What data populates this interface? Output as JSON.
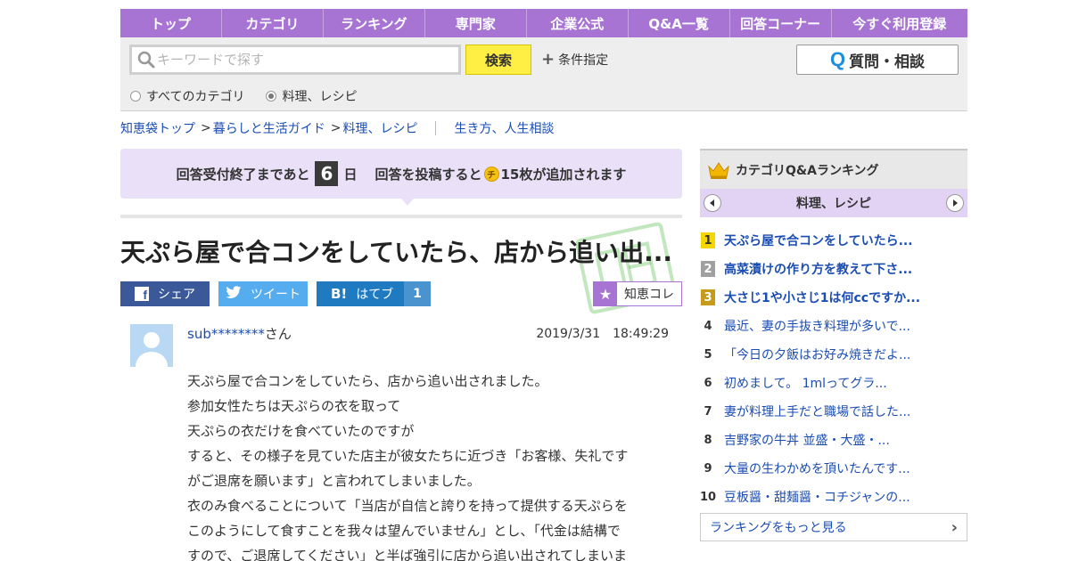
{
  "nav": {
    "items": [
      "トップ",
      "カテゴリ",
      "ランキング",
      "専門家",
      "企業公式",
      "Q&A一覧",
      "回答コーナー",
      "今すぐ利用登録"
    ]
  },
  "search": {
    "placeholder": "キーワードで探す",
    "button": "検索",
    "condition": "条件指定",
    "ask_button": "質問・相談",
    "ask_icon": "Q",
    "radio_all": "すべてのカテゴリ",
    "radio_cat": "料理、レシピ",
    "selected": "料理、レシピ"
  },
  "breadcrumb": {
    "items": [
      "知恵袋トップ",
      "暮らしと生活ガイド",
      "料理、レシピ"
    ],
    "separator": ">",
    "related": "生き方、人生相談"
  },
  "notice": {
    "prefix": "回答受付終了まであと",
    "days": "6",
    "unit": "日",
    "middle": "回答を投稿すると",
    "coin": "チ",
    "suffix": "15枚が追加されます"
  },
  "question": {
    "title": "天ぷら屋で合コンをしていたら、店から追い出...",
    "user": "sub********",
    "user_suffix": "さん",
    "datetime": "2019/3/31　18:49:29",
    "lines": [
      "天ぷら屋で合コンをしていたら、店から追い出されました。",
      "参加女性たちは天ぷらの衣を取って",
      "天ぷらの衣だけを食べていたのですが",
      "すると、その様子を見ていた店主が彼女たちに近づき「お客様、失礼です",
      "がご退席を願います」と言われてしまいました。",
      "衣のみ食べることについて「当店が自信と誇りを持って提供する天ぷらを",
      "このようにして食すことを我々は望んでいません」とし、「代金は結構で",
      "すので、ご退席してください」と半ば強引に店から追い出されてしまいま"
    ]
  },
  "share": {
    "facebook": "シェア",
    "facebook_icon": "f",
    "twitter": "ツイート",
    "hatena": "はてブ",
    "hatena_icon": "B!",
    "hatena_count": "1",
    "chiekore": "知恵コレ"
  },
  "ranking": {
    "title": "カテゴリQ&Aランキング",
    "category": "料理、レシピ",
    "items": [
      {
        "rank": "1",
        "text": "天ぷら屋で合コンをしていたら..."
      },
      {
        "rank": "2",
        "text": "高菜漬けの作り方を教えて下さ..."
      },
      {
        "rank": "3",
        "text": "大さじ1や小さじ1は何ccですか..."
      },
      {
        "rank": "4",
        "text": "最近、妻の手抜き料理が多いで..."
      },
      {
        "rank": "5",
        "text": "「今日の夕飯はお好み焼きだよ..."
      },
      {
        "rank": "6",
        "text": "初めまして。 1mlってグラ..."
      },
      {
        "rank": "7",
        "text": "妻が料理上手だと職場で話した..."
      },
      {
        "rank": "8",
        "text": "吉野家の牛丼 並盛・大盛・..."
      },
      {
        "rank": "9",
        "text": "大量の生わかめを頂いたんです..."
      },
      {
        "rank": "10",
        "text": "豆板醤・甜麺醤・コチジャンの..."
      }
    ],
    "more": "ランキングをもっと見る"
  },
  "colors": {
    "accent": "#a874d4",
    "search_button": "#ffee44",
    "link": "#1a4db3",
    "notice_bg": "#eae0f7"
  }
}
